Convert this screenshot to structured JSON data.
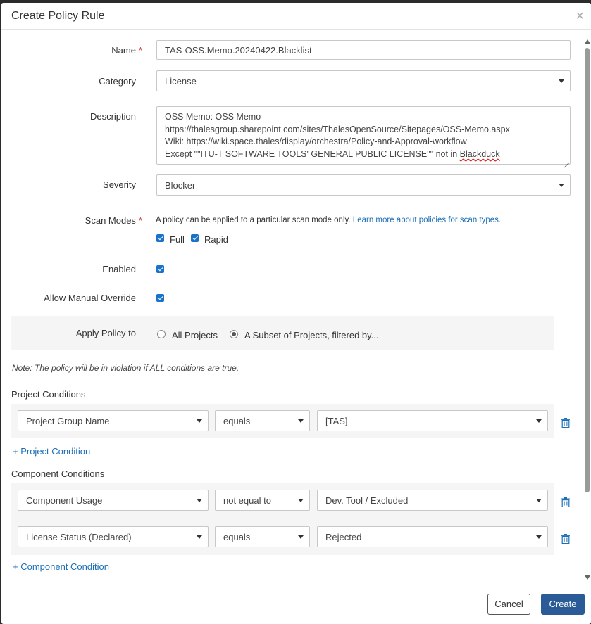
{
  "dialog": {
    "title": "Create Policy Rule",
    "close_label": "×"
  },
  "form": {
    "name": {
      "label": "Name",
      "required_mark": "*",
      "value": "TAS-OSS.Memo.20240422.Blacklist"
    },
    "category": {
      "label": "Category",
      "value": "License"
    },
    "description": {
      "label": "Description",
      "lines": [
        "OSS Memo: OSS Memo",
        "https://thalesgroup.sharepoint.com/sites/ThalesOpenSource/Sitepages/OSS-Memo.aspx",
        "Wiki: https://wiki.space.thales/display/orchestra/Policy-and-Approval-workflow",
        "Except \"\"ITU-T SOFTWARE TOOLS' GENERAL PUBLIC LICENSE\"\" not in ",
        "Blackduck"
      ]
    },
    "severity": {
      "label": "Severity",
      "value": "Blocker"
    },
    "scan_modes": {
      "label": "Scan Modes",
      "required_mark": "*",
      "hint": "A policy can be applied to a particular scan mode only. ",
      "hint_link": "Learn more about policies for scan types.",
      "full_label": "Full",
      "full_checked": true,
      "rapid_label": "Rapid",
      "rapid_checked": true
    },
    "enabled": {
      "label": "Enabled",
      "checked": true
    },
    "allow_override": {
      "label": "Allow Manual Override",
      "checked": true
    },
    "apply_policy": {
      "label": "Apply Policy to",
      "options": [
        "All Projects",
        "A Subset of Projects, filtered by..."
      ],
      "selected": "A Subset of Projects, filtered by..."
    }
  },
  "note": "Note: The policy will be in violation if ALL conditions are true.",
  "project_conditions": {
    "title": "Project Conditions",
    "rows": [
      {
        "field": "Project Group Name",
        "operator": "equals",
        "value": "[TAS]"
      }
    ],
    "add_label": "+ Project Condition"
  },
  "component_conditions": {
    "title": "Component Conditions",
    "rows": [
      {
        "field": "Component Usage",
        "operator": "not equal to",
        "value": "Dev. Tool / Excluded"
      },
      {
        "field": "License Status (Declared)",
        "operator": "equals",
        "value": "Rejected"
      }
    ],
    "add_label": "+ Component Condition"
  },
  "buttons": {
    "cancel": "Cancel",
    "create": "Create"
  },
  "colors": {
    "primary": "#2b5b96",
    "link": "#1c6fb6",
    "checkbox": "#1a73c8",
    "required": "#c9302c"
  }
}
